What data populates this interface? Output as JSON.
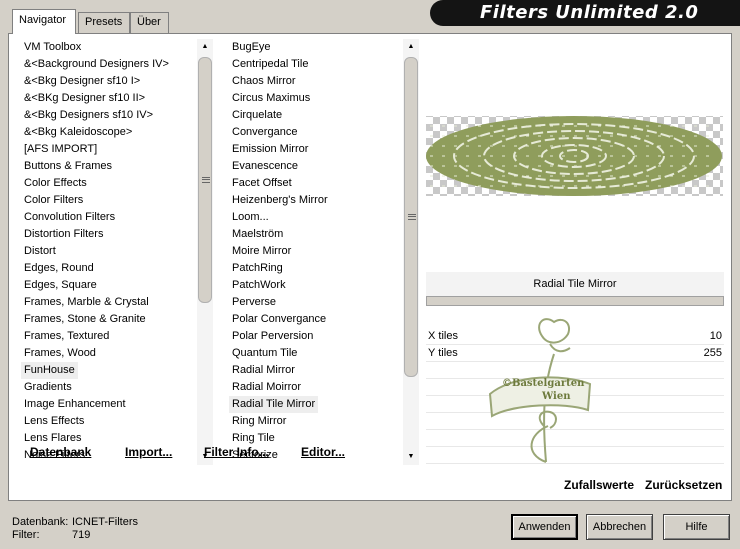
{
  "tabs": [
    {
      "label": "Navigator",
      "active": true
    },
    {
      "label": "Presets",
      "active": false
    },
    {
      "label": "Über",
      "active": false
    }
  ],
  "app_title": "Filters Unlimited 2.0",
  "categories": [
    "VM Toolbox",
    "&<Background Designers IV>",
    "&<Bkg Designer sf10 I>",
    "&<BKg Designer sf10 II>",
    "&<Bkg Designers sf10 IV>",
    "&<Bkg Kaleidoscope>",
    "[AFS IMPORT]",
    "Buttons & Frames",
    "Color Effects",
    "Color Filters",
    "Convolution Filters",
    "Distortion Filters",
    "Distort",
    "Edges, Round",
    "Edges, Square",
    "Frames, Marble & Crystal",
    "Frames, Stone & Granite",
    "Frames, Textured",
    "Frames, Wood",
    "FunHouse",
    "Gradients",
    "Image Enhancement",
    "Lens Effects",
    "Lens Flares",
    "Noise Filters"
  ],
  "selected_category": "FunHouse",
  "filters": [
    "BugEye",
    "Centripedal Tile",
    "Chaos Mirror",
    "Circus Maximus",
    "Cirquelate",
    "Convergance",
    "Emission Mirror",
    "Evanescence",
    "Facet Offset",
    "Heizenberg's Mirror",
    "Loom...",
    "Maelström",
    "Moire Mirror",
    "PatchRing",
    "PatchWork",
    "Perverse",
    "Polar Convergance",
    "Polar Perversion",
    "Quantum Tile",
    "Radial Mirror",
    "Radial Moirror",
    "Radial Tile Mirror",
    "Ring Mirror",
    "Ring Tile",
    "Sectorize"
  ],
  "selected_filter": "Radial Tile Mirror",
  "panel_buttons": {
    "database": "Datenbank",
    "import": "Import...",
    "filter_info": "Filter Info...",
    "editor": "Editor..."
  },
  "preview": {
    "filter_name": "Radial Tile Mirror",
    "params": [
      {
        "label": "X tiles",
        "value": "10"
      },
      {
        "label": "Y tiles",
        "value": "255"
      }
    ],
    "watermark_line1": "©Bastelgarten",
    "watermark_line2": "Wien",
    "ellipse_color": "#8f9d5c"
  },
  "random_label": "Zufallswerte",
  "reset_label": "Zurücksetzen",
  "status": {
    "database_label": "Datenbank:",
    "database_value": "ICNET-Filters",
    "filter_label": "Filter:",
    "filter_value": "719"
  },
  "buttons": {
    "apply": "Anwenden",
    "cancel": "Abbrechen",
    "help": "Hilfe"
  }
}
